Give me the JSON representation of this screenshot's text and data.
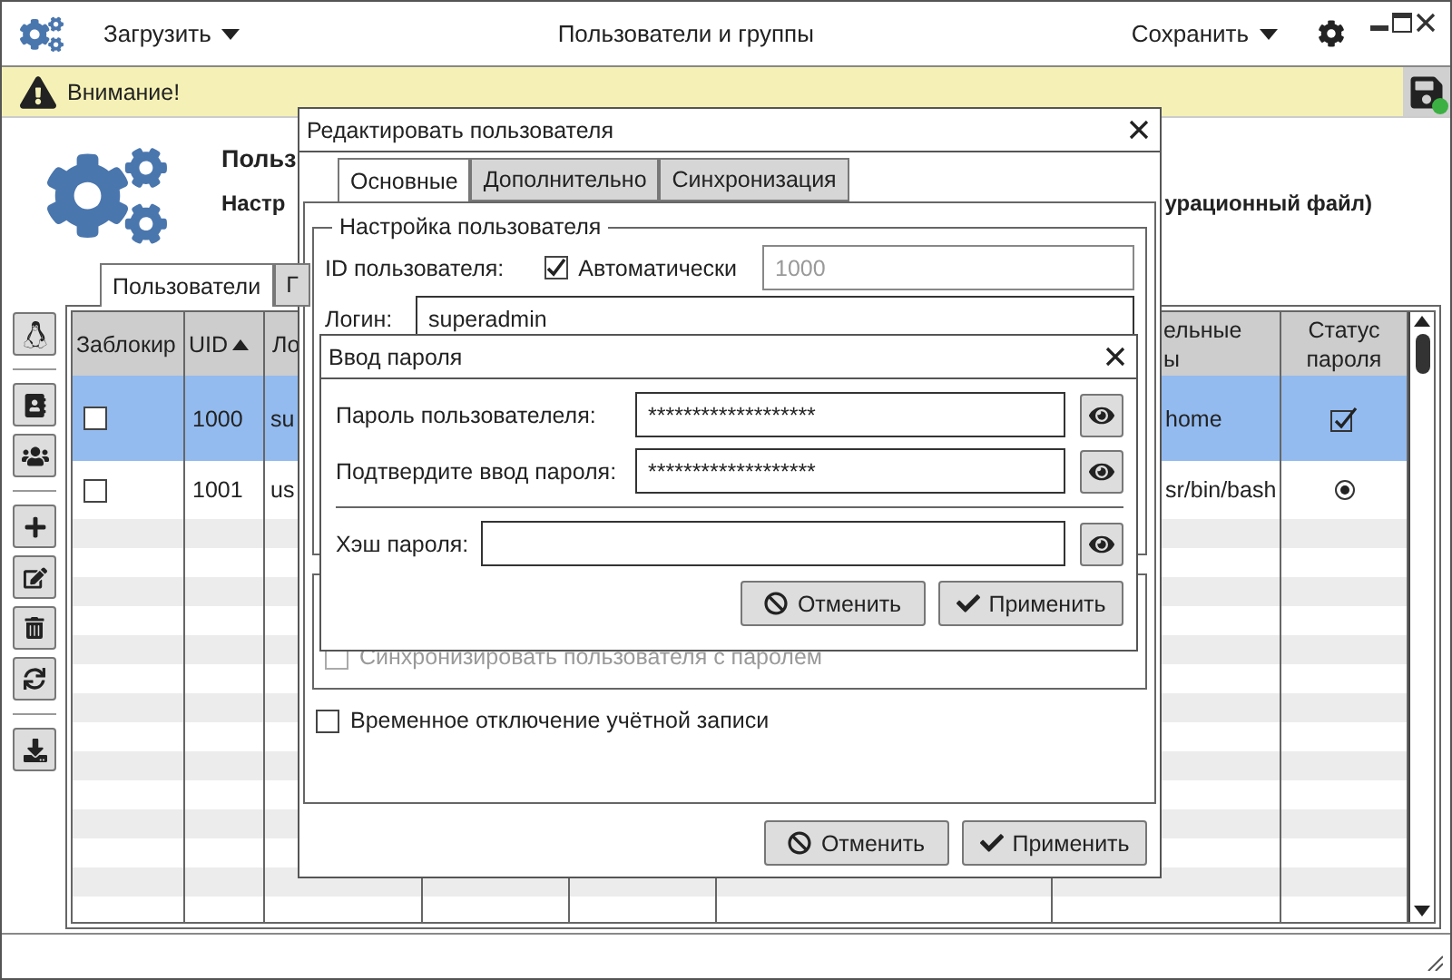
{
  "window": {
    "title": "Пользователи и группы",
    "menus": [
      {
        "label": "Загрузить"
      },
      {
        "label": "Сохранить"
      }
    ]
  },
  "warning": {
    "text": "Внимание!"
  },
  "header": {
    "title": "Польз",
    "subtitle": "Настр",
    "subtitle_tail": "урационный файл)"
  },
  "tabs": [
    {
      "label": "Пользователи",
      "selected": true
    },
    {
      "label": "Г",
      "selected": false
    }
  ],
  "table": {
    "columns": [
      {
        "lines": [
          "Заблокир"
        ]
      },
      {
        "lines": [
          "UID"
        ],
        "sorted": true
      },
      {
        "lines": [
          "Ло"
        ]
      },
      {
        "lines": [
          "ельные",
          "ы"
        ]
      },
      {
        "lines": [
          "Статус",
          "пароля"
        ]
      }
    ],
    "rows": [
      {
        "selected": true,
        "locked": false,
        "uid": "1000",
        "login": "su",
        "column_7": "home",
        "password_set": true
      },
      {
        "selected": false,
        "locked": false,
        "uid": "1001",
        "login": "us",
        "column_7": "sr/bin/bash",
        "password_set": false
      }
    ]
  },
  "dialog": {
    "title": "Редактировать пользователя",
    "tabs": [
      {
        "label": "Основные",
        "selected": true
      },
      {
        "label": "Дополнительно",
        "selected": false
      },
      {
        "label": "Синхронизация",
        "selected": false
      }
    ],
    "group_title": "Настройка пользователя",
    "id_label": "ID пользователя:",
    "auto": {
      "label": "Автоматически",
      "checked": true
    },
    "id_value": "1000",
    "id_disabled": true,
    "login_label": "Логин:",
    "login_value": "superadmin",
    "sync": {
      "label": "Синхронизировать пользователя с паролем",
      "checked": false,
      "disabled": true
    },
    "disable_account": {
      "label": "Временное отключение учётной записи",
      "checked": false
    },
    "buttons": [
      {
        "kind": "cancel",
        "label": "Отменить"
      },
      {
        "kind": "apply",
        "label": "Применить"
      }
    ]
  },
  "password_dialog": {
    "title": "Ввод пароля",
    "fields": [
      {
        "label": "Пароль пользователеля:",
        "value": "*******************"
      },
      {
        "label": "Подтвердите ввод пароля:",
        "value": "*******************"
      },
      {
        "label": "Хэш пароля:"
      }
    ],
    "buttons": [
      {
        "kind": "cancel",
        "label": "Отменить"
      },
      {
        "kind": "apply",
        "label": "Применить"
      }
    ]
  }
}
